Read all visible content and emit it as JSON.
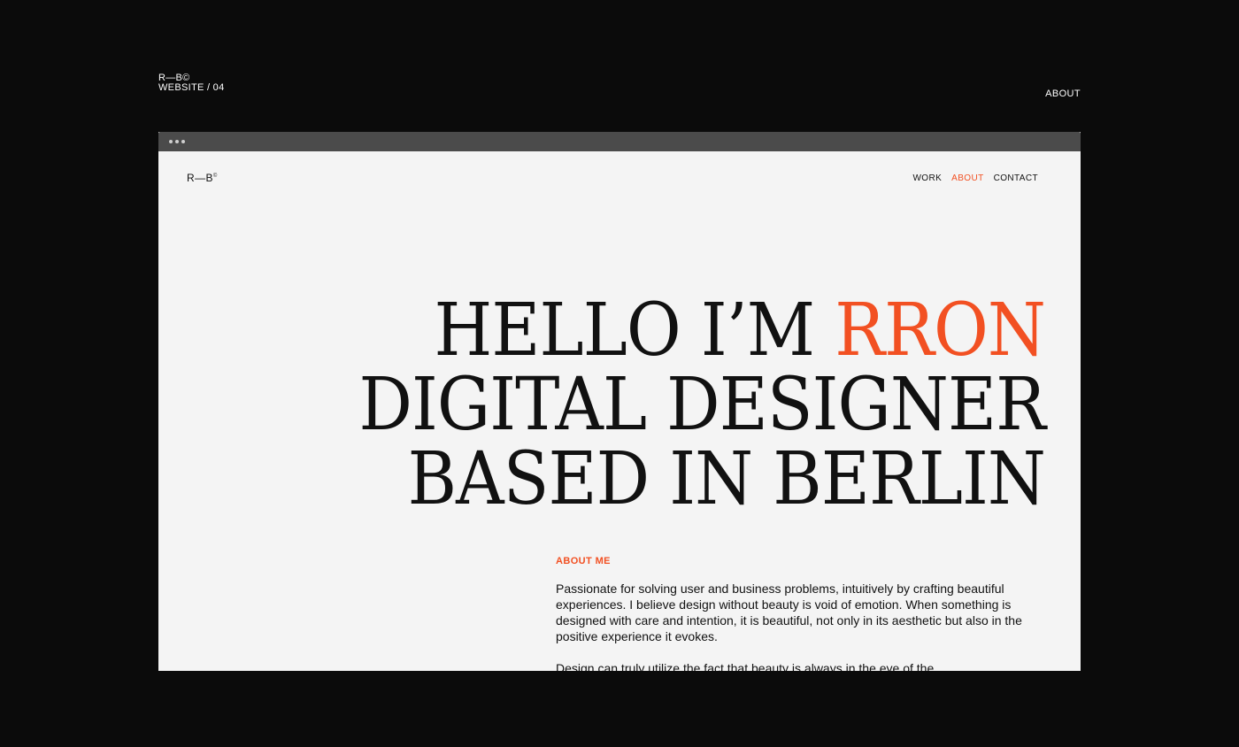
{
  "outer": {
    "brand_line1": "R—B©",
    "brand_line2": "WEBSITE / 04",
    "about_link": "ABOUT"
  },
  "browser": {
    "site": {
      "logo": "R—B",
      "logo_sup": "©",
      "nav": {
        "work": "WORK",
        "about": "ABOUT",
        "contact": "CONTACT"
      },
      "hero": {
        "line1_a": "HELLO I’M ",
        "line1_b": "RRON",
        "line2": "DIGITAL DESIGNER",
        "line3": "BASED IN BERLIN"
      },
      "about": {
        "heading": "ABOUT ME",
        "paragraph1": "Passionate for solving user and business problems, intuitively by crafting beautiful experiences. I believe design without beauty is void of emotion. When something is designed with care and intention, it is beautiful, not only in its aesthetic but also in the positive experience it evokes.",
        "paragraph2": "Design can truly utilize the fact that beauty is always in the eye of the"
      }
    }
  },
  "colors": {
    "accent": "#f25022",
    "background_outer": "#0b0b0b",
    "background_site": "#f4f4f4",
    "browser_bar": "#4b4b4b"
  }
}
